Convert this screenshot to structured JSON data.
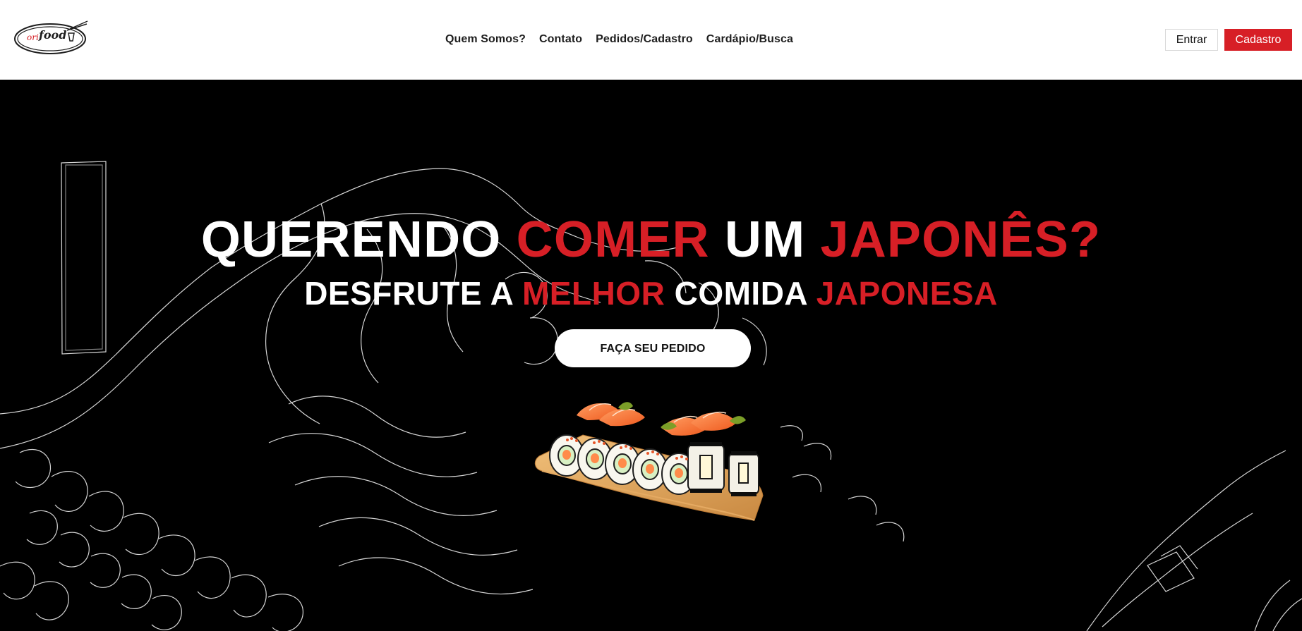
{
  "header": {
    "logo": {
      "text_a": "ori",
      "text_b": "food",
      "icon": "chopsticks-bowl-logo-icon"
    },
    "nav": [
      {
        "label": "Quem Somos?"
      },
      {
        "label": "Contato"
      },
      {
        "label": "Pedidos/Cadastro"
      },
      {
        "label": "Cardápio/Busca"
      }
    ],
    "auth": {
      "enter_label": "Entrar",
      "signup_label": "Cadastro"
    }
  },
  "hero": {
    "headline": {
      "part1": "QUERENDO ",
      "part2": "COMER",
      "part3": " UM ",
      "part4": "JAPONÊS?"
    },
    "subheadline": {
      "part1": "DESFRUTE A ",
      "part2": "MELHOR",
      "part3": " COMIDA ",
      "part4": "JAPONESA"
    },
    "cta_label": "FAÇA SEU PEDIDO",
    "background_icon": "great-wave-line-art-icon",
    "image_icon": "sushi-platter-icon"
  },
  "colors": {
    "accent": "#d71f26",
    "hero_background": "#000000",
    "text_light": "#ffffff",
    "text_dark": "#1e1e1e"
  }
}
